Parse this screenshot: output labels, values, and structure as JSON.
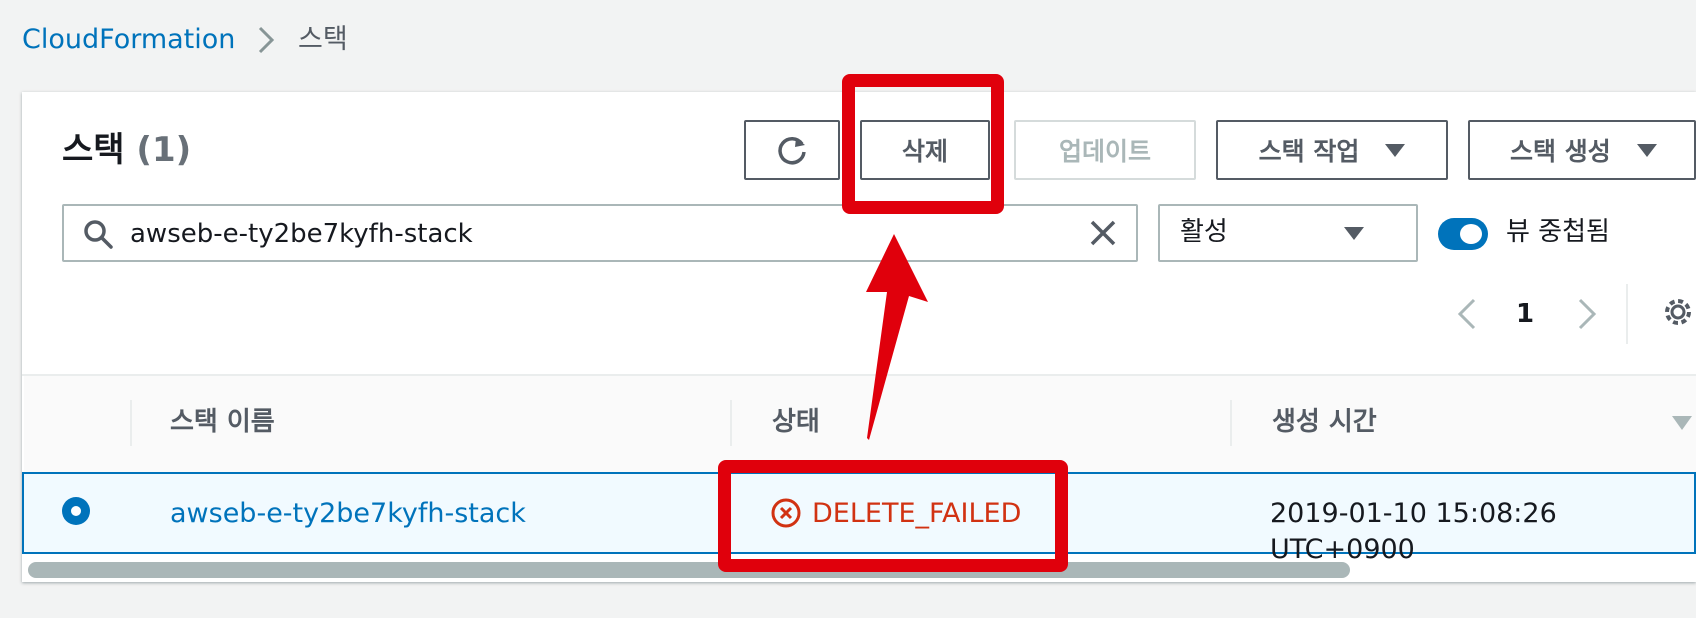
{
  "breadcrumb": {
    "root": "CloudFormation",
    "current": "스택"
  },
  "panel": {
    "title": "스택",
    "count": "(1)"
  },
  "toolbar": {
    "refresh_icon": "refresh-icon",
    "delete_label": "삭제",
    "update_label": "업데이트",
    "actions_label": "스택 작업",
    "create_label": "스택 생성"
  },
  "filter": {
    "search_value": "awseb-e-ty2be7kyfh-stack",
    "status_select": "활성",
    "toggle_label": "뷰 중첩됨",
    "toggle_on": true
  },
  "pagination": {
    "page": "1"
  },
  "table": {
    "columns": [
      "스택 이름",
      "상태",
      "생성 시간"
    ],
    "rows": [
      {
        "name": "awseb-e-ty2be7kyfh-stack",
        "status": "DELETE_FAILED",
        "created": "2019-01-10 15:08:26 UTC+0900",
        "selected": true
      }
    ]
  },
  "colors": {
    "link": "#0073bb",
    "error": "#d13212",
    "annotation": "#e0000c"
  }
}
